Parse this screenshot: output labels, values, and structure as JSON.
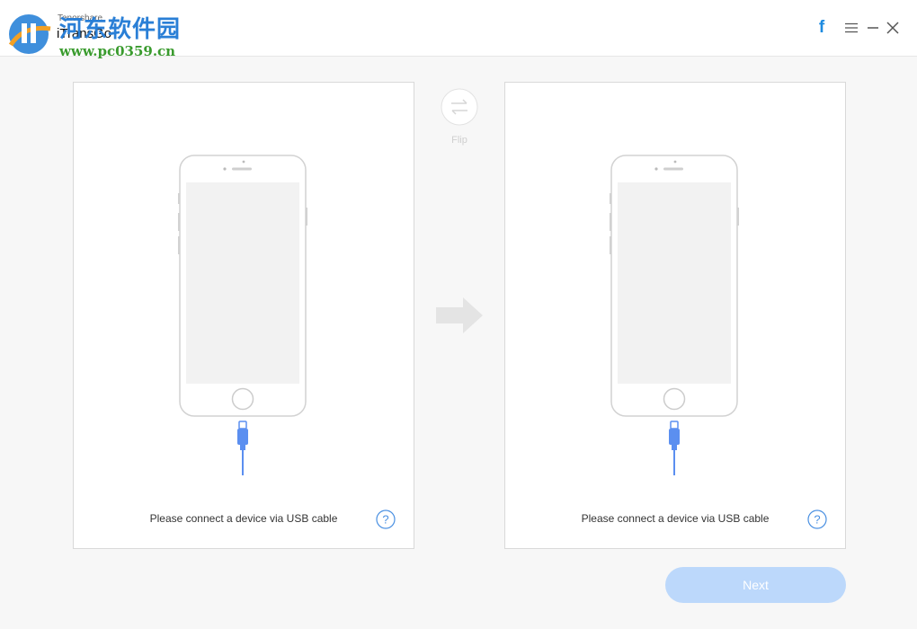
{
  "watermark": {
    "site_name": "河东软件园",
    "url": "www.pc0359.cn"
  },
  "app": {
    "vendor": "Tenorshare",
    "name": "iTransGo"
  },
  "window_controls": {
    "facebook_glyph": "f"
  },
  "source_panel": {
    "message": "Please connect a device via USB cable",
    "help_glyph": "?"
  },
  "target_panel": {
    "message": "Please connect a device via USB cable",
    "help_glyph": "?"
  },
  "flip": {
    "label": "Flip",
    "glyph": "⇄"
  },
  "next_button": {
    "label": "Next"
  },
  "colors": {
    "accent": "#1d8be0",
    "next_disabled": "#bcd8fb",
    "cable": "#5b8ff0",
    "screen": "#f2f2f2",
    "arrow": "#e6e6e6"
  }
}
